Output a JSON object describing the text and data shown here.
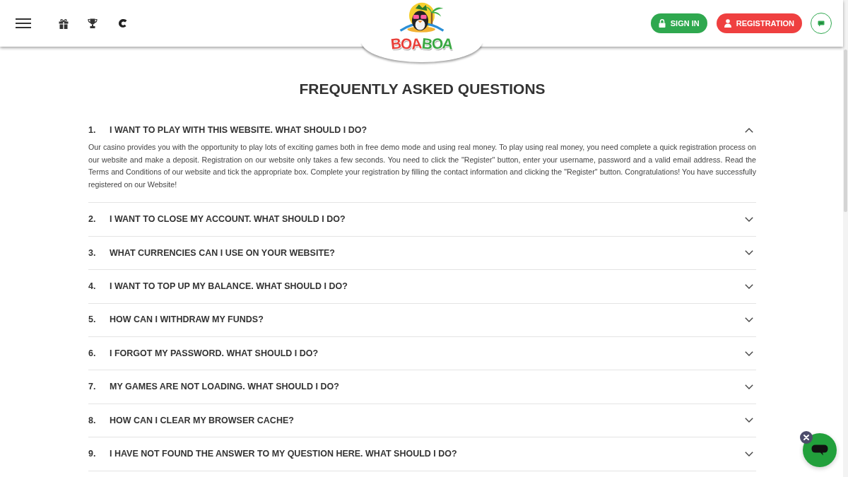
{
  "header": {
    "logo": {
      "text": "BOABOA"
    },
    "buttons": [
      {
        "label": "SIGN IN",
        "kind": "signin"
      },
      {
        "label": "REGISTRATION",
        "kind": "register"
      }
    ]
  },
  "title": "FREQUENTLY ASKED QUESTIONS",
  "faq": [
    {
      "number": "1.",
      "question": "I WANT TO PLAY WITH THIS WEBSITE. WHAT SHOULD I DO?",
      "expanded": true,
      "answer": "Our casino provides you with the opportunity to play lots of exciting games both in free demo mode and using real money. To play using real money, you need complete a quick registration process on our website and make a deposit. Registration on our website only takes a few seconds. You need to click the \"Register\" button, enter your username, password and a valid email address. Read the Terms and Conditions of our website and tick the appropriate box. Complete your registration by filling the contact information and clicking the \"Register\" button. Congratulations! You have successfully registered on our Website!"
    },
    {
      "number": "2.",
      "question": "I WANT TO CLOSE MY ACCOUNT. WHAT SHOULD I DO?",
      "expanded": false
    },
    {
      "number": "3.",
      "question": "WHAT CURRENCIES CAN I USE ON YOUR WEBSITE?",
      "expanded": false
    },
    {
      "number": "4.",
      "question": "I WANT TO TOP UP MY BALANCE. WHAT SHOULD I DO?",
      "expanded": false
    },
    {
      "number": "5.",
      "question": "HOW CAN I WITHDRAW MY FUNDS?",
      "expanded": false
    },
    {
      "number": "6.",
      "question": "I FORGOT MY PASSWORD. WHAT SHOULD I DO?",
      "expanded": false
    },
    {
      "number": "7.",
      "question": "MY GAMES ARE NOT LOADING. WHAT SHOULD I DO?",
      "expanded": false
    },
    {
      "number": "8.",
      "question": "HOW CAN I CLEAR MY BROWSER CACHE?",
      "expanded": false
    },
    {
      "number": "9.",
      "question": "I HAVE NOT FOUND THE ANSWER TO MY QUESTION HERE. WHAT SHOULD I DO?",
      "expanded": false
    }
  ]
}
